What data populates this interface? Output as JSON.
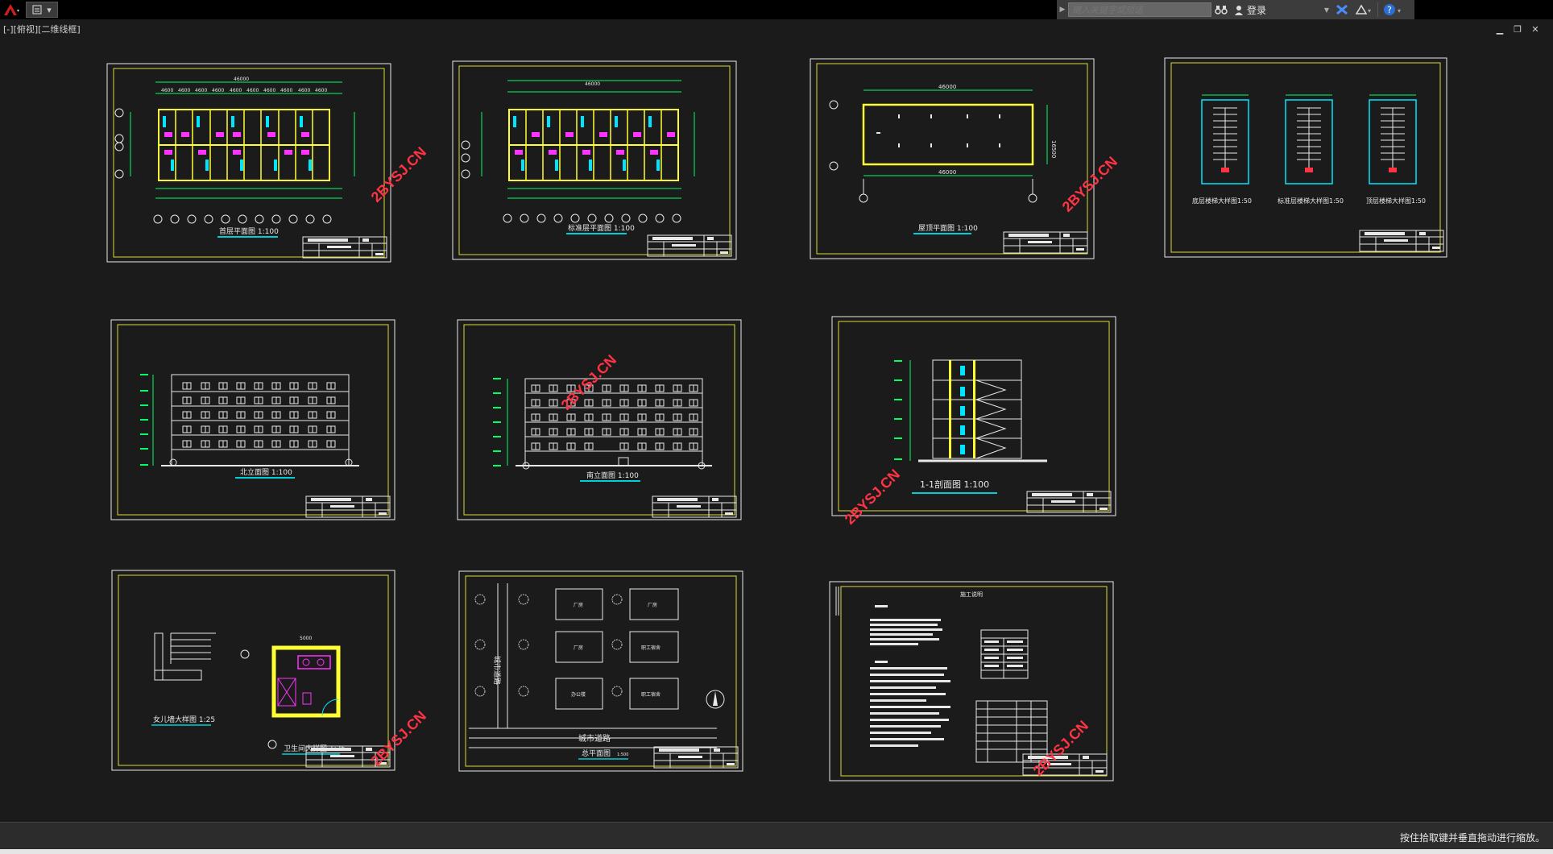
{
  "app": {
    "search_placeholder": "键入关键字或短语",
    "login_label": "登录",
    "viewport_label": "[-][俯视][二维线框]",
    "status_message": "按住拾取键并垂直拖动进行缩放。",
    "watermark": "2BYSJ.CN"
  },
  "sheets": {
    "ground_floor_plan": {
      "title": "首层平面图 1:100",
      "overall_dim": "46000",
      "dims": [
        "4600",
        "4600",
        "4600",
        "4600",
        "4600",
        "4600",
        "4600",
        "4600",
        "4600",
        "4600"
      ]
    },
    "standard_floor_plan": {
      "title": "标准层平面图 1:100",
      "overall_dim": "46000"
    },
    "roof_plan": {
      "title": "屋顶平面图 1:100",
      "dim_top": "46000",
      "dim_bottom": "46000",
      "dim_side": "16500"
    },
    "stairs": {
      "title1": "底层楼梯大样图1:50",
      "title2": "标准层楼梯大样图1:50",
      "title3": "顶层楼梯大样图1:50"
    },
    "north_elevation": {
      "title": "北立面图 1:100"
    },
    "south_elevation": {
      "title": "南立面图 1:100"
    },
    "section": {
      "title": "1-1剖面图 1:100"
    },
    "details": {
      "title1": "女儿墙大样图 1:25",
      "title2": "卫生间大样图 1:25",
      "dim": "5000"
    },
    "site_plan": {
      "title": "总平面图",
      "scale": "1:500",
      "road": "城市道路",
      "side_road": "城市道路",
      "building_labels": [
        "厂房",
        "厂房",
        "厂房",
        "职工宿舍",
        "办公楼",
        "职工宿舍"
      ]
    },
    "notes": {
      "title": "施工说明"
    }
  },
  "colors": {
    "frame": "#d8d83a",
    "border": "#e8e8e8",
    "wall": "#ffff33",
    "cyan": "#00e5ff",
    "green": "#00ff66",
    "magenta": "#ff33ff",
    "watermark": "#ff3344",
    "title_underline": "#00cfd8"
  }
}
